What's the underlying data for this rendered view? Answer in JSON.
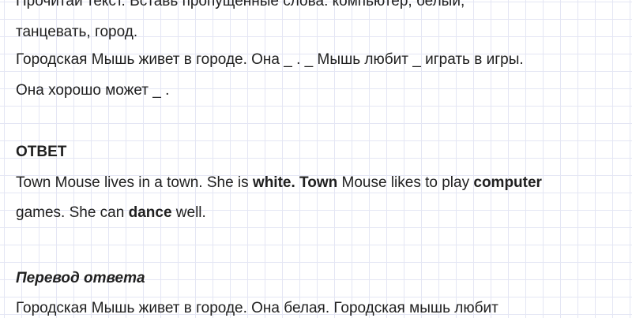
{
  "task": {
    "line_1": "Прочитай текст. Вставь пропущенные слова: компьютер, белый,",
    "line_2": "танцевать, город.",
    "line_3": "Городская Мышь живет в городе. Она _ . _ Мышь любит _ играть в игры.",
    "line_4": "Она хорошо может _ ."
  },
  "answer": {
    "heading": "ОТВЕТ",
    "line_1": {
      "seg_1": "Town Mouse lives in a town. She is ",
      "bold_1": "white. Town",
      "seg_2": " Mouse likes to play ",
      "bold_2": "computer"
    },
    "line_2": {
      "seg_1": "games. She can ",
      "bold_1": "dance",
      "seg_2": " well."
    }
  },
  "translation": {
    "heading": "Перевод ответа",
    "line_1": "Городская Мышь живет в городе. Она белая. Городская мышь любит"
  }
}
